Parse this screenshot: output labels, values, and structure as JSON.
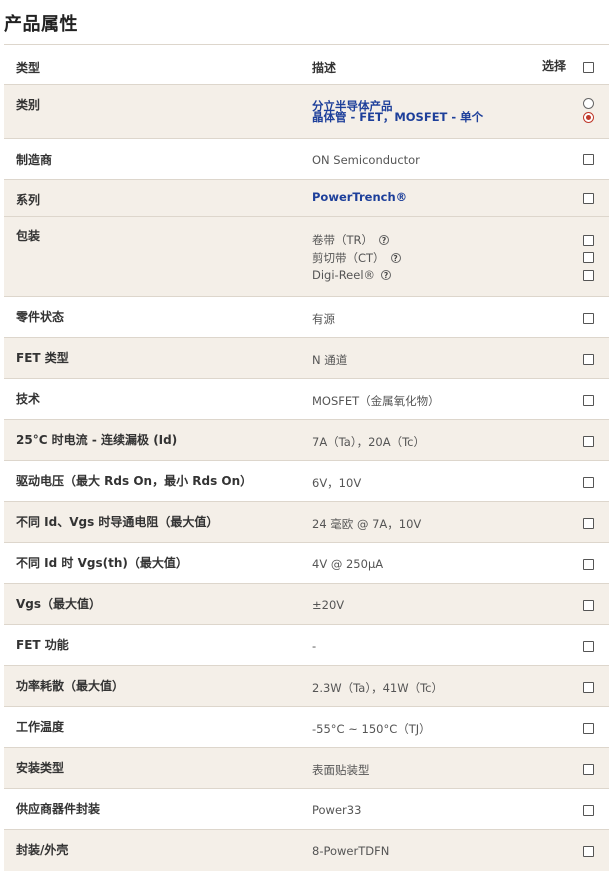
{
  "page_title": "产品属性",
  "header": {
    "attribute": "类型",
    "description": "描述",
    "select": "选择"
  },
  "category": {
    "label": "类别",
    "line1": "分立半导体产品",
    "line2": "晶体管 - FET，MOSFET - 单个"
  },
  "manufacturer": {
    "label": "制造商",
    "value": "ON Semiconductor"
  },
  "series": {
    "label": "系列",
    "value": "PowerTrench®"
  },
  "packaging": {
    "label": "包装",
    "options": [
      "卷带（TR）",
      "剪切带（CT）",
      "Digi-Reel®"
    ],
    "help_glyph": "?"
  },
  "rows": [
    {
      "label": "零件状态",
      "value": "有源"
    },
    {
      "label": "FET 类型",
      "value": "N 通道"
    },
    {
      "label": "技术",
      "value": "MOSFET（金属氧化物）"
    },
    {
      "label": "25°C 时电流 - 连续漏极 (Id)",
      "value": "7A（Ta），20A（Tc）"
    },
    {
      "label": "驱动电压（最大 Rds On，最小 Rds On）",
      "value": "6V，10V"
    },
    {
      "label": "不同 Id、Vgs 时导通电阻（最大值）",
      "value": "24 毫欧 @ 7A，10V"
    },
    {
      "label": "不同 Id 时 Vgs(th)（最大值）",
      "value": "4V @ 250µA"
    },
    {
      "label": "Vgs（最大值）",
      "value": "±20V"
    },
    {
      "label": "FET 功能",
      "value": "-"
    },
    {
      "label": "功率耗散（最大值）",
      "value": "2.3W（Ta），41W（Tc）"
    },
    {
      "label": "工作温度",
      "value": "-55°C ~ 150°C（TJ）"
    },
    {
      "label": "安装类型",
      "value": "表面贴装型"
    },
    {
      "label": "供应商器件封装",
      "value": "Power33"
    },
    {
      "label": "封装/外壳",
      "value": "8-PowerTDFN"
    }
  ],
  "colors": {
    "row_alt": "#f4efe8",
    "link": "#1d3f9a",
    "radio_checked": "#c0392b"
  }
}
